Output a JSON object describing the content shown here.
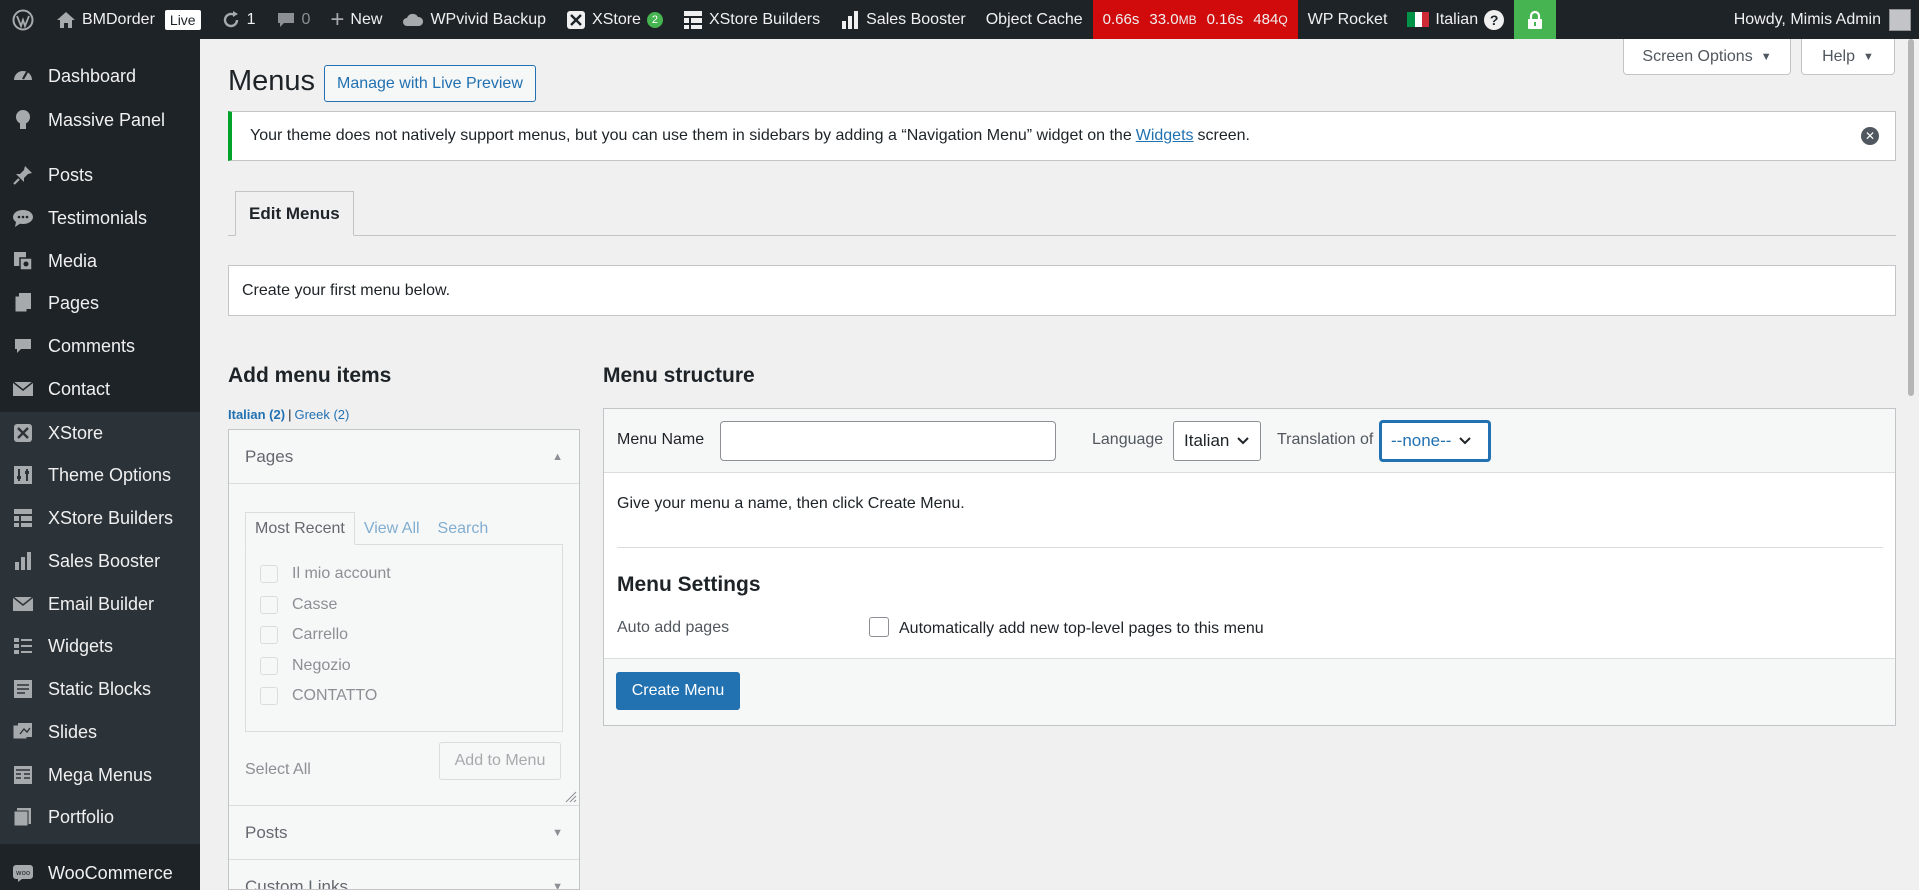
{
  "adminbar": {
    "site_name": "BMDorder",
    "live_badge": "Live",
    "updates_count": "1",
    "comments_count": "0",
    "new_label": "New",
    "wpvivid_label": "WPvivid Backup",
    "xstore_label": "XStore",
    "xstore_count": "2",
    "xstore_builders_label": "XStore Builders",
    "sales_booster_label": "Sales Booster",
    "object_cache_label": "Object Cache",
    "perf_time": "0.66s",
    "perf_mem_value": "33.0",
    "perf_mem_unit": "MB",
    "perf_query_time": "0.16s",
    "perf_queries_value": "484",
    "perf_queries_unit": "Q",
    "wp_rocket_label": "WP Rocket",
    "language_label": "Italian",
    "howdy": "Howdy, Mimis Admin"
  },
  "sidebar": {
    "items": [
      {
        "label": "Dashboard",
        "icon": "dashboard-icon"
      },
      {
        "label": "Massive Panel",
        "icon": "lightbulb-icon"
      },
      {
        "label": "Posts",
        "icon": "pin-icon"
      },
      {
        "label": "Testimonials",
        "icon": "speech-bubble-icon"
      },
      {
        "label": "Media",
        "icon": "media-icon"
      },
      {
        "label": "Pages",
        "icon": "pages-icon"
      },
      {
        "label": "Comments",
        "icon": "comment-icon"
      },
      {
        "label": "Contact",
        "icon": "envelope-icon"
      },
      {
        "label": "XStore",
        "icon": "xstore-icon"
      },
      {
        "label": "Theme Options",
        "icon": "sliders-icon"
      },
      {
        "label": "XStore Builders",
        "icon": "grid-icon"
      },
      {
        "label": "Sales Booster",
        "icon": "bar-chart-icon"
      },
      {
        "label": "Email Builder",
        "icon": "mail-icon"
      },
      {
        "label": "Widgets",
        "icon": "widgets-icon"
      },
      {
        "label": "Static Blocks",
        "icon": "blocks-icon"
      },
      {
        "label": "Slides",
        "icon": "slides-icon"
      },
      {
        "label": "Mega Menus",
        "icon": "mega-menu-icon"
      },
      {
        "label": "Portfolio",
        "icon": "portfolio-icon"
      },
      {
        "label": "WooCommerce",
        "icon": "woo-icon"
      }
    ]
  },
  "screen_options_label": "Screen Options",
  "help_label": "Help",
  "page": {
    "title": "Menus",
    "live_preview_label": "Manage with Live Preview",
    "notice_before": "Your theme does not natively support menus, but you can use them in sidebars by adding a “Navigation Menu” widget on the",
    "notice_link": "Widgets",
    "notice_after": "screen.",
    "tab_edit_menus": "Edit Menus",
    "first_menu_text": "Create your first menu below."
  },
  "add_items": {
    "title": "Add menu items",
    "lang_current": "Italian (2)",
    "lang_sep": "|",
    "lang_other": "Greek (2)",
    "pages_heading": "Pages",
    "tabs": [
      "Most Recent",
      "View All",
      "Search"
    ],
    "pages": [
      "Il mio account",
      "Casse",
      "Carrello",
      "Negozio",
      "CONTATTO"
    ],
    "select_all": "Select All",
    "add_to_menu": "Add to Menu",
    "posts_heading": "Posts",
    "custom_links_heading": "Custom Links"
  },
  "menu_structure": {
    "title": "Menu structure",
    "menu_name_label": "Menu Name",
    "menu_name_value": "",
    "language_label": "Language",
    "language_value": "Italian",
    "translation_label": "Translation of",
    "translation_value": "--none--",
    "hint": "Give your menu a name, then click Create Menu.",
    "settings_title": "Menu Settings",
    "auto_add_label": "Auto add pages",
    "auto_add_checked": false,
    "auto_add_text": "Automatically add new top-level pages to this menu",
    "create_button": "Create Menu"
  },
  "colors": {
    "admin_bar": "#1d2327",
    "accent": "#2271b1",
    "notice_success": "#00a32a",
    "perf_red": "#d10b0b",
    "lock_green": "#46b450"
  }
}
